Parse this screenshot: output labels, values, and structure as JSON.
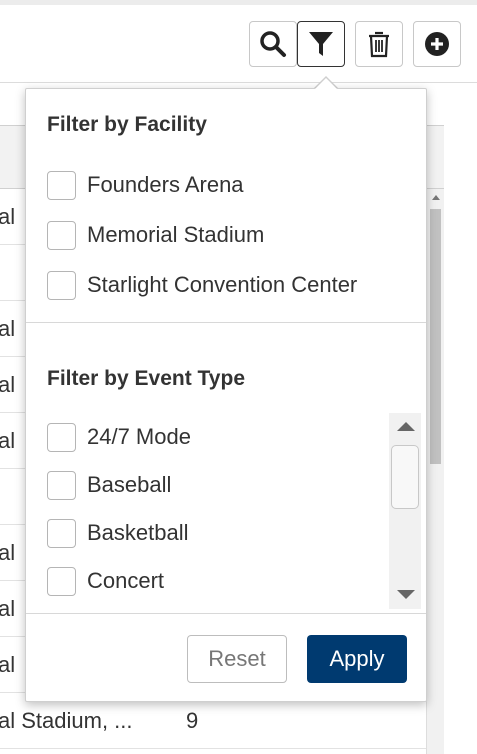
{
  "toolbar": {
    "icons": [
      "search-icon",
      "filter-icon",
      "trash-icon",
      "plus-circle-icon"
    ]
  },
  "background_table": {
    "rows": [
      {
        "c1": "al",
        "c2": ""
      },
      {
        "c1": "al",
        "c2": ""
      },
      {
        "c1": "al",
        "c2": ""
      },
      {
        "c1": "",
        "c2": ""
      },
      {
        "c1": "al",
        "c2": ""
      },
      {
        "c1": "al",
        "c2": ""
      },
      {
        "c1": "al",
        "c2": ""
      },
      {
        "c1": "al Stadium, ...",
        "c2": "9"
      }
    ]
  },
  "filter": {
    "facility_title": "Filter by Facility",
    "facilities": [
      "Founders Arena",
      "Memorial Stadium",
      "Starlight Convention Center"
    ],
    "event_type_title": "Filter by Event Type",
    "event_types": [
      "24/7 Mode",
      "Baseball",
      "Basketball",
      "Concert"
    ],
    "reset_label": "Reset",
    "apply_label": "Apply"
  },
  "colors": {
    "apply_bg": "#003a70",
    "border": "#cfcfcf"
  }
}
